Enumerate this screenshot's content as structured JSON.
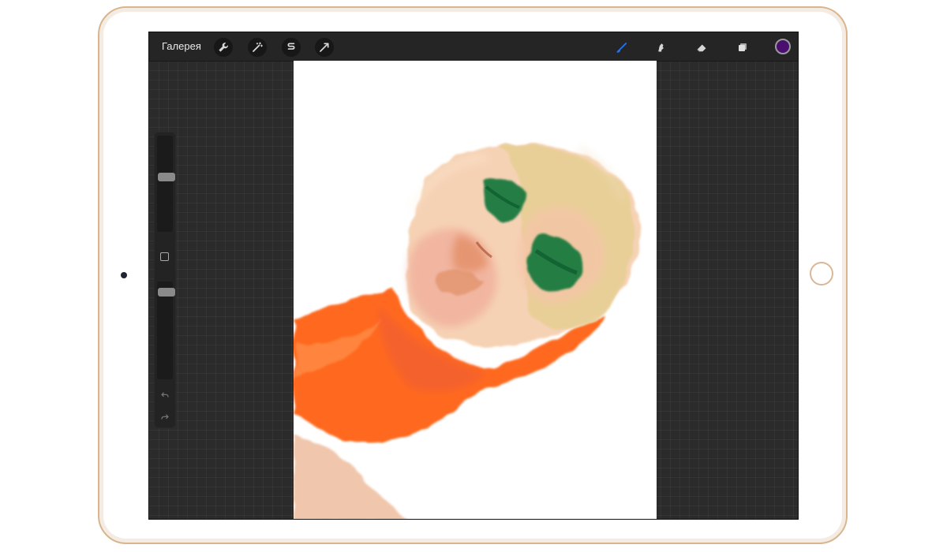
{
  "toolbar": {
    "gallery_label": "Галерея",
    "left_tools": [
      {
        "name": "actions",
        "icon": "wrench-icon"
      },
      {
        "name": "adjustments",
        "icon": "magic-wand-icon"
      },
      {
        "name": "selection",
        "icon": "selection-s-icon"
      },
      {
        "name": "transform",
        "icon": "transform-arrow-icon"
      }
    ],
    "right_tools": [
      {
        "name": "brush",
        "icon": "brush-icon",
        "active": true
      },
      {
        "name": "smudge",
        "icon": "smudge-icon",
        "active": false
      },
      {
        "name": "eraser",
        "icon": "eraser-icon",
        "active": false
      },
      {
        "name": "layers",
        "icon": "layers-icon",
        "active": false
      }
    ],
    "active_color": "#4a0d70"
  },
  "sidebar": {
    "brush_size": 0.58,
    "opacity": 0.93,
    "modify_icon": "square-icon",
    "undo_icon": "undo-icon",
    "redo_icon": "redo-icon"
  },
  "canvas": {
    "background": "#ffffff",
    "painting_colors": {
      "skin": "#f2c6a6",
      "highlight": "#ead19a",
      "shadow": "#e39a82",
      "orange": "#ff6414",
      "green": "#1b7a3f"
    }
  },
  "device": {
    "frame_color": "#d8b58d",
    "camera_icon": "camera-icon",
    "home_button_icon": "home-button-icon"
  }
}
